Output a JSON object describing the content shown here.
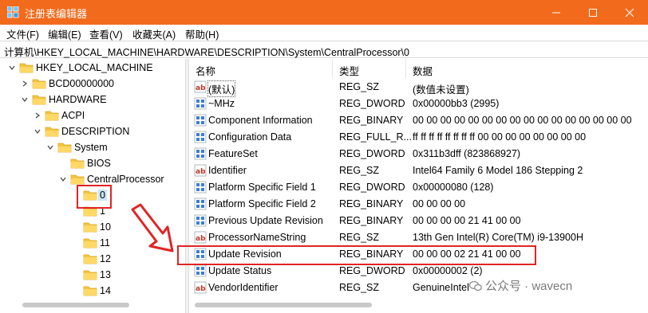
{
  "window": {
    "title": "注册表编辑器",
    "titlebar_color": "#f26b1d"
  },
  "menu": [
    "文件(F)",
    "编辑(E)",
    "查看(V)",
    "收藏夹(A)",
    "帮助(H)"
  ],
  "address": "计算机\\HKEY_LOCAL_MACHINE\\HARDWARE\\DESCRIPTION\\System\\CentralProcessor\\0",
  "tree": [
    {
      "label": "HKEY_LOCAL_MACHINE",
      "expanded": true
    },
    {
      "label": "BCD00000000",
      "expanded": false
    },
    {
      "label": "HARDWARE",
      "expanded": true
    },
    {
      "label": "ACPI",
      "expanded": false
    },
    {
      "label": "DESCRIPTION",
      "expanded": true
    },
    {
      "label": "System",
      "expanded": true
    },
    {
      "label": "BIOS"
    },
    {
      "label": "CentralProcessor",
      "expanded": true
    },
    {
      "label": "0",
      "selected": true
    },
    {
      "label": "1"
    },
    {
      "label": "10"
    },
    {
      "label": "11"
    },
    {
      "label": "12"
    },
    {
      "label": "13"
    },
    {
      "label": "14"
    }
  ],
  "columns": {
    "name": "名称",
    "type": "类型",
    "data": "数据"
  },
  "values": [
    {
      "name": "(默认)",
      "type": "REG_SZ",
      "data": "(数值未设置)",
      "icon": "string-value-icon"
    },
    {
      "name": "~MHz",
      "type": "REG_DWORD",
      "data": "0x00000bb3 (2995)",
      "icon": "binary-value-icon"
    },
    {
      "name": "Component Information",
      "type": "REG_BINARY",
      "data": "00 00 00 00 00 00 00 00 00 00 00 00 00 00 00 00",
      "icon": "binary-value-icon"
    },
    {
      "name": "Configuration Data",
      "type": "REG_FULL_R...",
      "data": "ff ff ff ff ff ff ff ff 00 00 00 00 00 00 00 00",
      "icon": "binary-value-icon"
    },
    {
      "name": "FeatureSet",
      "type": "REG_DWORD",
      "data": "0x311b3dff (823868927)",
      "icon": "binary-value-icon"
    },
    {
      "name": "Identifier",
      "type": "REG_SZ",
      "data": "Intel64 Family 6 Model 186 Stepping 2",
      "icon": "string-value-icon"
    },
    {
      "name": "Platform Specific Field 1",
      "type": "REG_DWORD",
      "data": "0x00000080 (128)",
      "icon": "binary-value-icon"
    },
    {
      "name": "Platform Specific Field 2",
      "type": "REG_BINARY",
      "data": "00 00 00 00",
      "icon": "binary-value-icon"
    },
    {
      "name": "Previous Update Revision",
      "type": "REG_BINARY",
      "data": "00 00 00 00 21 41 00 00",
      "icon": "binary-value-icon"
    },
    {
      "name": "ProcessorNameString",
      "type": "REG_SZ",
      "data": "13th Gen Intel(R) Core(TM) i9-13900H",
      "icon": "string-value-icon"
    },
    {
      "name": "Update Revision",
      "type": "REG_BINARY",
      "data": "00 00 00 02 21 41 00 00",
      "icon": "binary-value-icon"
    },
    {
      "name": "Update Status",
      "type": "REG_DWORD",
      "data": "0x00000002 (2)",
      "icon": "binary-value-icon"
    },
    {
      "name": "VendorIdentifier",
      "type": "REG_SZ",
      "data": "GenuineIntel",
      "icon": "string-value-icon"
    }
  ],
  "watermark": "公众号 · wavecn",
  "highlight_color": "#e12424"
}
